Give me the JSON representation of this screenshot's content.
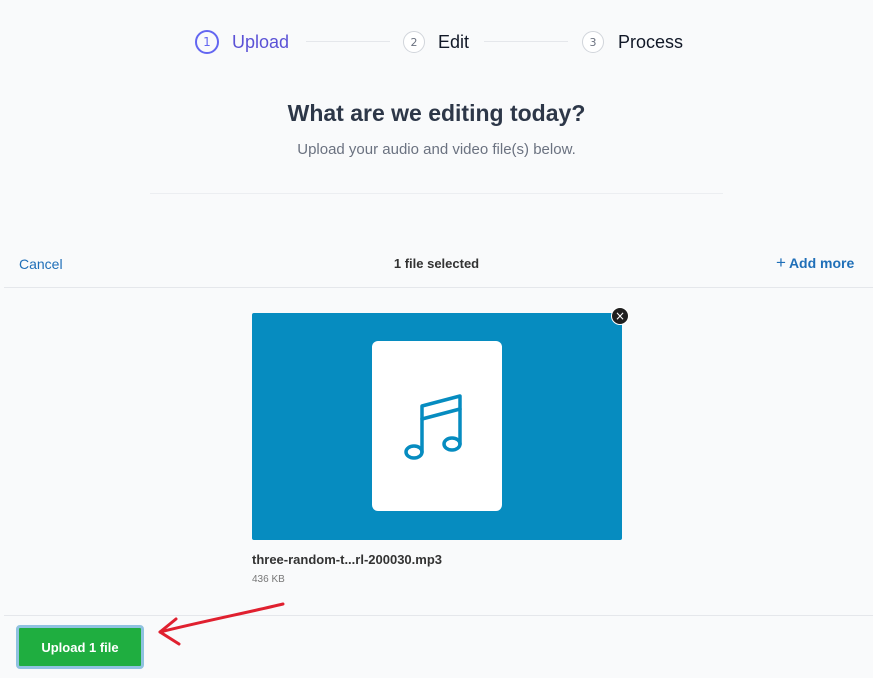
{
  "stepper": {
    "steps": [
      {
        "number": "1",
        "label": "Upload"
      },
      {
        "number": "2",
        "label": "Edit"
      },
      {
        "number": "3",
        "label": "Process"
      }
    ]
  },
  "heading": {
    "title": "What are we editing today?",
    "subtitle": "Upload your audio and video file(s) below."
  },
  "uploader": {
    "cancel_label": "Cancel",
    "status": "1 file selected",
    "add_more_label": "Add more",
    "file": {
      "name": "three-random-t...rl-200030.mp3",
      "size": "436 KB",
      "remove_symbol": "×"
    },
    "upload_button_label": "Upload 1 file"
  },
  "colors": {
    "accent": "#6366f1",
    "link": "#1f6fb8",
    "preview_bg": "#068cc0",
    "upload_button": "#1fae40",
    "annotation_arrow": "#e0202f"
  },
  "icons": {
    "file_icon": "music-note-icon",
    "remove_icon": "close-icon",
    "add_icon": "plus-icon"
  }
}
